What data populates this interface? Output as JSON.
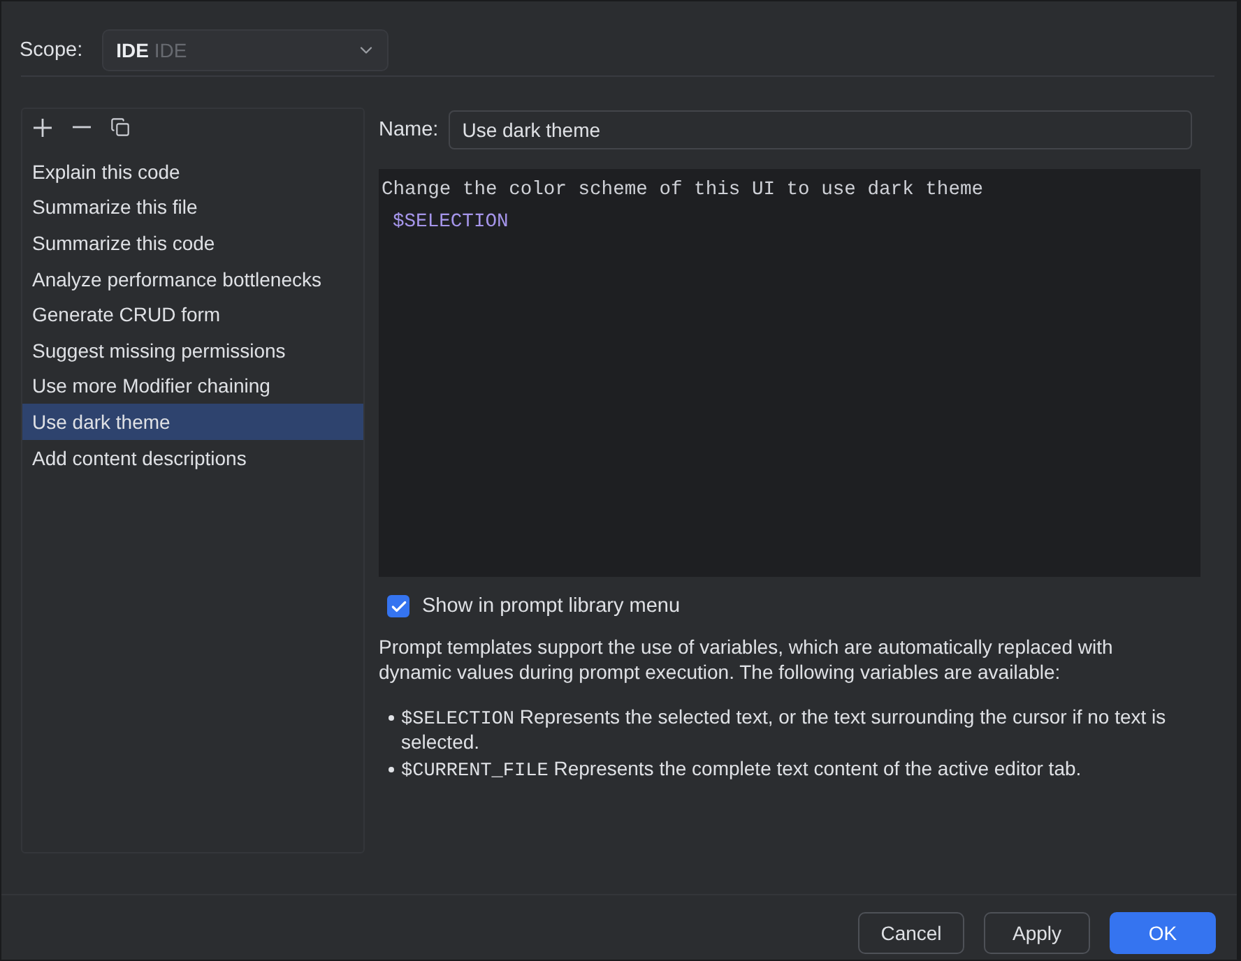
{
  "scope": {
    "label": "Scope:",
    "value": "IDE",
    "hint": "IDE"
  },
  "prompts": [
    {
      "label": "Explain this code",
      "selected": false
    },
    {
      "label": "Summarize this file",
      "selected": false
    },
    {
      "label": "Summarize this code",
      "selected": false
    },
    {
      "label": "Analyze performance bottlenecks",
      "selected": false
    },
    {
      "label": "Generate CRUD form",
      "selected": false
    },
    {
      "label": "Suggest missing permissions",
      "selected": false
    },
    {
      "label": "Use more Modifier chaining",
      "selected": false
    },
    {
      "label": "Use dark theme",
      "selected": true
    },
    {
      "label": "Add content descriptions",
      "selected": false
    }
  ],
  "name": {
    "label": "Name:",
    "value": "Use dark theme"
  },
  "editor": {
    "lines": [
      {
        "kind": "text",
        "text": "Change the color scheme of this UI to use dark theme"
      },
      {
        "kind": "variable",
        "text": "$SELECTION"
      }
    ]
  },
  "show_in_menu": {
    "label": "Show in prompt library menu",
    "checked": true
  },
  "help": {
    "intro": "Prompt templates support the use of variables, which are automatically replaced with dynamic values during prompt execution. The following variables are available:",
    "variables": [
      {
        "name": "$SELECTION",
        "description": "Represents the selected text, or the text surrounding the cursor if no text is selected."
      },
      {
        "name": "$CURRENT_FILE",
        "description": "Represents the complete text content of the active editor tab."
      }
    ]
  },
  "buttons": [
    {
      "label": "Cancel",
      "kind": "secondary"
    },
    {
      "label": "Apply",
      "kind": "secondary"
    },
    {
      "label": "OK",
      "kind": "primary"
    }
  ]
}
